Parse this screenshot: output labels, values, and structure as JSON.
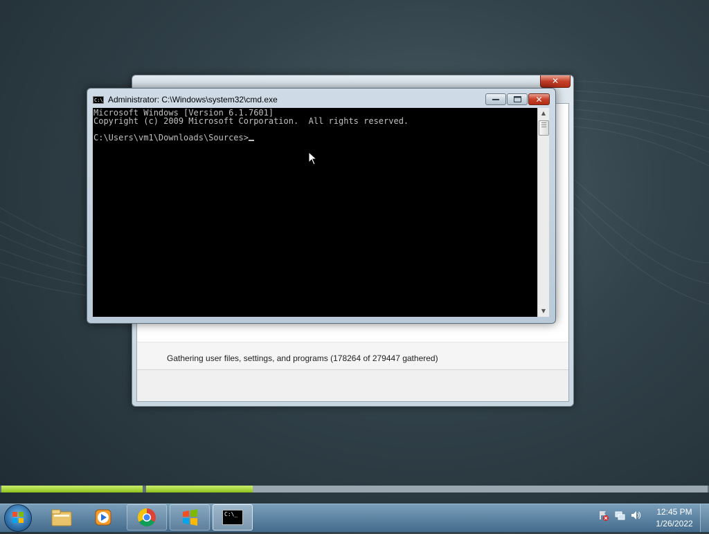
{
  "cmd_window": {
    "title": "Administrator: C:\\Windows\\system32\\cmd.exe",
    "icon_text": "C:\\.",
    "lines": [
      "Microsoft Windows [Version 6.1.7601]",
      "Copyright (c) 2009 Microsoft Corporation.  All rights reserved.",
      "",
      "C:\\Users\\vm1\\Downloads\\Sources>"
    ],
    "minimize_label": "—",
    "maximize_label": "□",
    "close_label": "✕"
  },
  "transfer_window": {
    "close_label": "✕",
    "status_text": "Gathering user files, settings, and programs (178264 of 279447 gathered)"
  },
  "progress": {
    "left_fraction": 1.0,
    "right_fraction": 0.19,
    "fill_color": "#8ec21c"
  },
  "taskbar": {
    "items": [
      {
        "name": "windows-explorer-icon"
      },
      {
        "name": "media-player-icon"
      },
      {
        "name": "chrome-icon"
      },
      {
        "name": "windows-easy-transfer-icon"
      },
      {
        "name": "cmd-icon",
        "label": "C:\\_"
      }
    ],
    "clock_time": "12:45 PM",
    "clock_date": "1/26/2022"
  },
  "colors": {
    "console_bg": "#000000",
    "console_fg": "#c0c0c0",
    "close_red": "#c7402a"
  }
}
